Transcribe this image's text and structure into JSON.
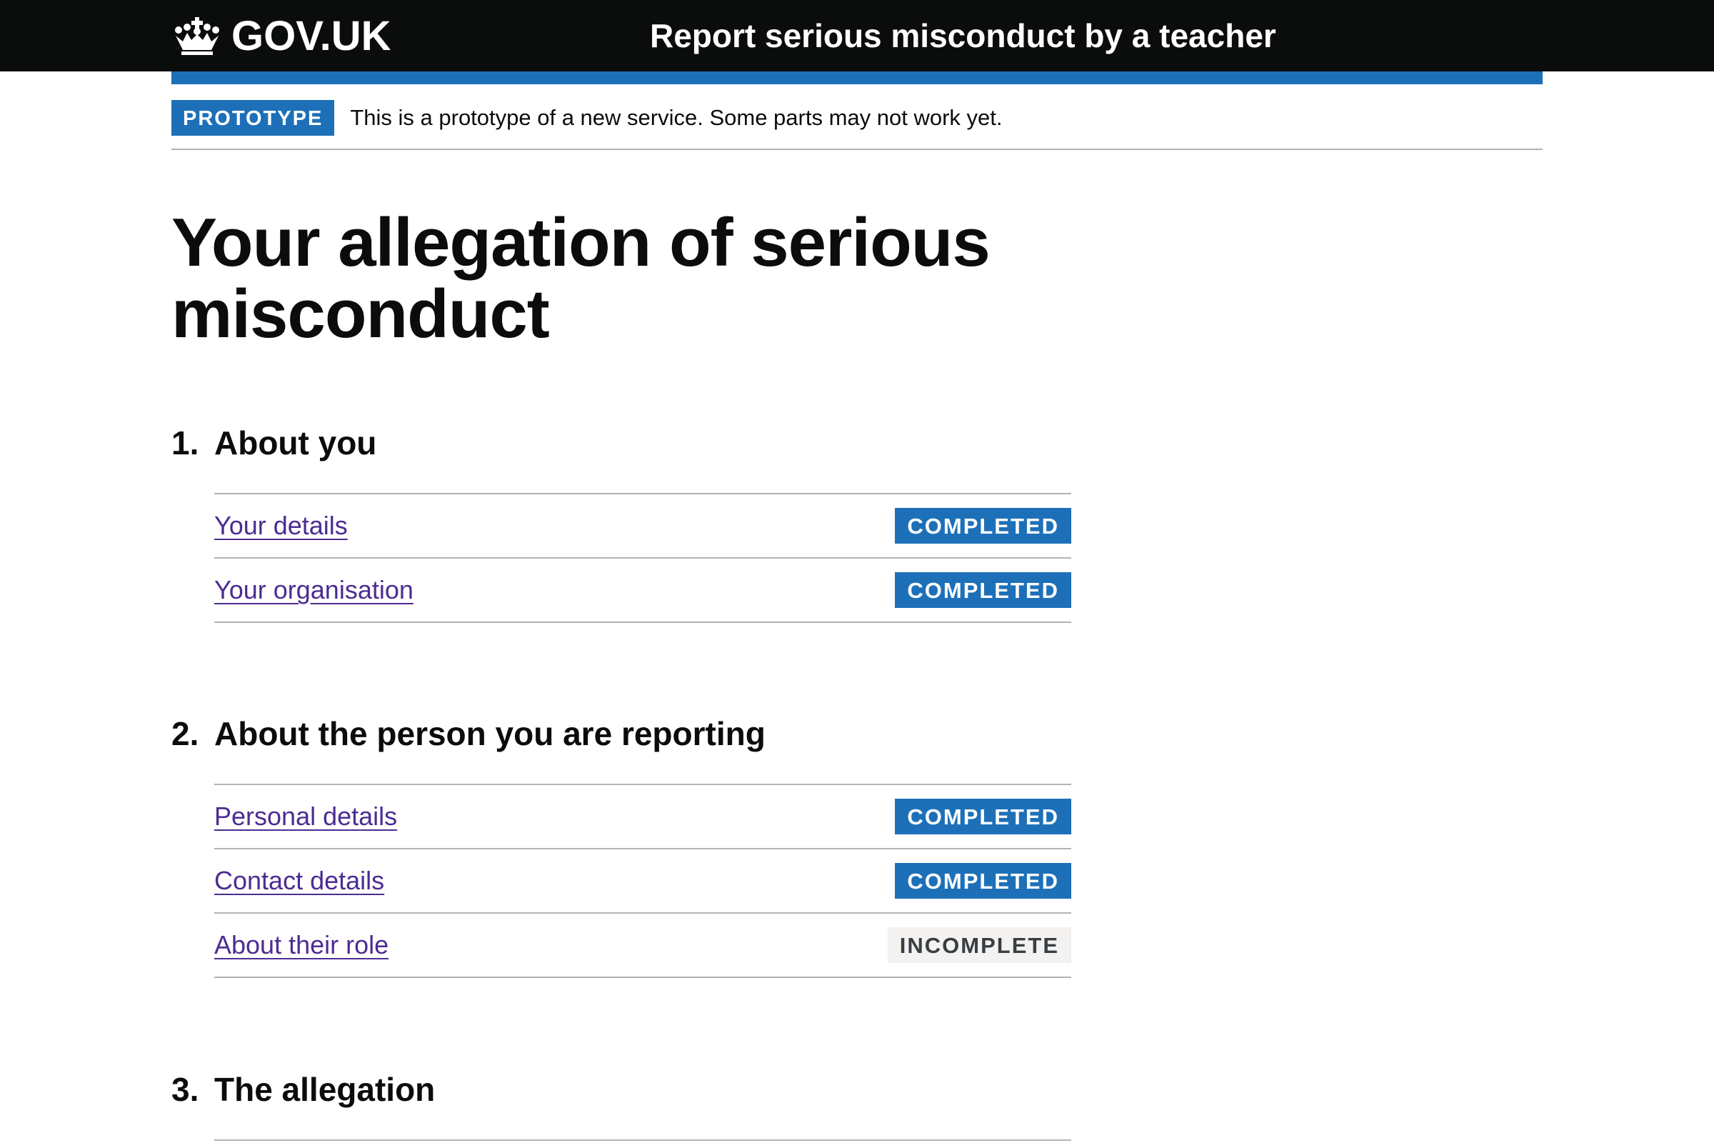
{
  "header": {
    "logo_text": "GOV.UK",
    "service_name": "Report serious misconduct by a teacher"
  },
  "phase_banner": {
    "tag": "PROTOTYPE",
    "text": "This is a prototype of a new service. Some parts may not work yet."
  },
  "page": {
    "title": "Your allegation of serious misconduct"
  },
  "sections": [
    {
      "number": "1.",
      "heading": "About you",
      "tasks": [
        {
          "label": "Your details",
          "status": "COMPLETED"
        },
        {
          "label": "Your organisation",
          "status": "COMPLETED"
        }
      ]
    },
    {
      "number": "2.",
      "heading": "About the person you are reporting",
      "tasks": [
        {
          "label": "Personal details",
          "status": "COMPLETED"
        },
        {
          "label": "Contact details",
          "status": "COMPLETED"
        },
        {
          "label": "About their role",
          "status": "INCOMPLETE"
        }
      ]
    },
    {
      "number": "3.",
      "heading": "The allegation",
      "tasks": []
    }
  ],
  "colors": {
    "header_bg": "#0b0c0c",
    "brand_blue": "#1d70b8",
    "link_visited": "#4c2c92",
    "incomplete_bg": "#f3f2f1",
    "border": "#b1b4b6"
  },
  "icons": {
    "logo": "crown-icon"
  }
}
